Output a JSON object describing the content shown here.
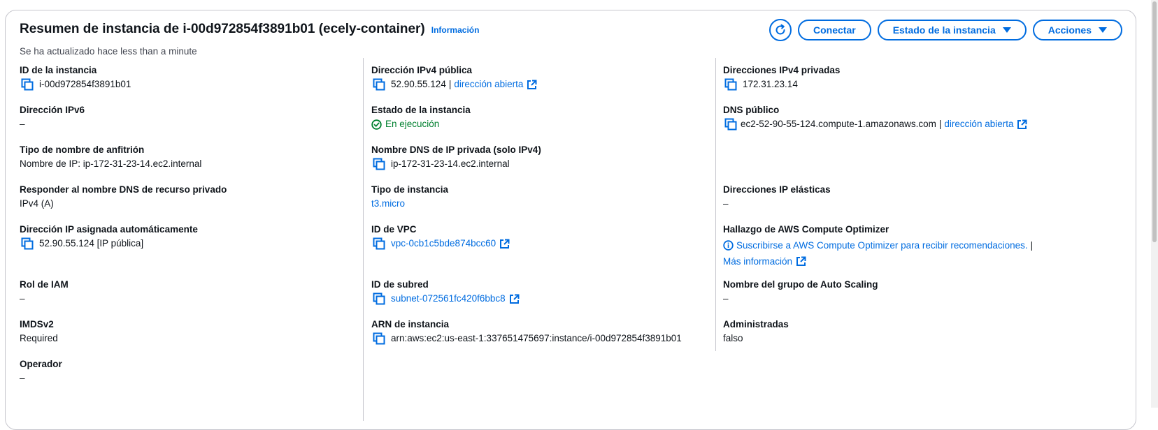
{
  "header": {
    "title": "Resumen de instancia de i-00d972854f3891b01 (ecely-container)",
    "info_link": "Información",
    "subtitle": "Se ha actualizado hace less than a minute"
  },
  "actions": {
    "refresh_icon": "refresh-icon",
    "connect": "Conectar",
    "instance_state": "Estado de la instancia",
    "actions": "Acciones"
  },
  "col1": {
    "instance_id": {
      "label": "ID de la instancia",
      "value": "i-00d972854f3891b01"
    },
    "ipv6": {
      "label": "Dirección IPv6",
      "value": "–"
    },
    "hostname_type": {
      "label": "Tipo de nombre de anfitrión",
      "value": "Nombre de IP: ip-172-31-23-14.ec2.internal"
    },
    "dns_resource": {
      "label": "Responder al nombre DNS de recurso privado",
      "value": "IPv4 (A)"
    },
    "auto_ip": {
      "label": "Dirección IP asignada automáticamente",
      "value": "52.90.55.124 [IP pública]"
    },
    "iam_role": {
      "label": "Rol de IAM",
      "value": "–"
    },
    "imdsv2": {
      "label": "IMDSv2",
      "value": "Required"
    },
    "operator": {
      "label": "Operador",
      "value": "–"
    }
  },
  "col2": {
    "public_ipv4": {
      "label": "Dirección IPv4 pública",
      "value": "52.90.55.124",
      "sep": "|",
      "link": "dirección abierta"
    },
    "instance_state": {
      "label": "Estado de la instancia",
      "value": "En ejecución"
    },
    "private_dns": {
      "label": "Nombre DNS de IP privada (solo IPv4)",
      "value": "ip-172-31-23-14.ec2.internal"
    },
    "instance_type": {
      "label": "Tipo de instancia",
      "value": "t3.micro"
    },
    "vpc_id": {
      "label": "ID de VPC",
      "value": "vpc-0cb1c5bde874bcc60"
    },
    "subnet_id": {
      "label": "ID de subred",
      "value": "subnet-072561fc420f6bbc8"
    },
    "arn": {
      "label": "ARN de instancia",
      "value": "arn:aws:ec2:us-east-1:337651475697:instance/i-00d972854f3891b01"
    }
  },
  "col3": {
    "private_ipv4": {
      "label": "Direcciones IPv4 privadas",
      "value": "172.31.23.14"
    },
    "public_dns": {
      "label": "DNS público",
      "value": "ec2-52-90-55-124.compute-1.amazonaws.com",
      "sep": "|",
      "link": "dirección abierta"
    },
    "elastic_ip": {
      "label": "Direcciones IP elásticas",
      "value": "–"
    },
    "optimizer": {
      "label": "Hallazgo de AWS Compute Optimizer",
      "value": "Suscribirse a AWS Compute Optimizer para recibir recomendaciones.",
      "sep": "|",
      "more": "Más información"
    },
    "asg_name": {
      "label": "Nombre del grupo de Auto Scaling",
      "value": "–"
    },
    "managed": {
      "label": "Administradas",
      "value": "falso"
    }
  },
  "colors": {
    "accent": "#006ce0",
    "success": "#00802f",
    "text": "#0f141a",
    "border": "#c6c6cd"
  }
}
